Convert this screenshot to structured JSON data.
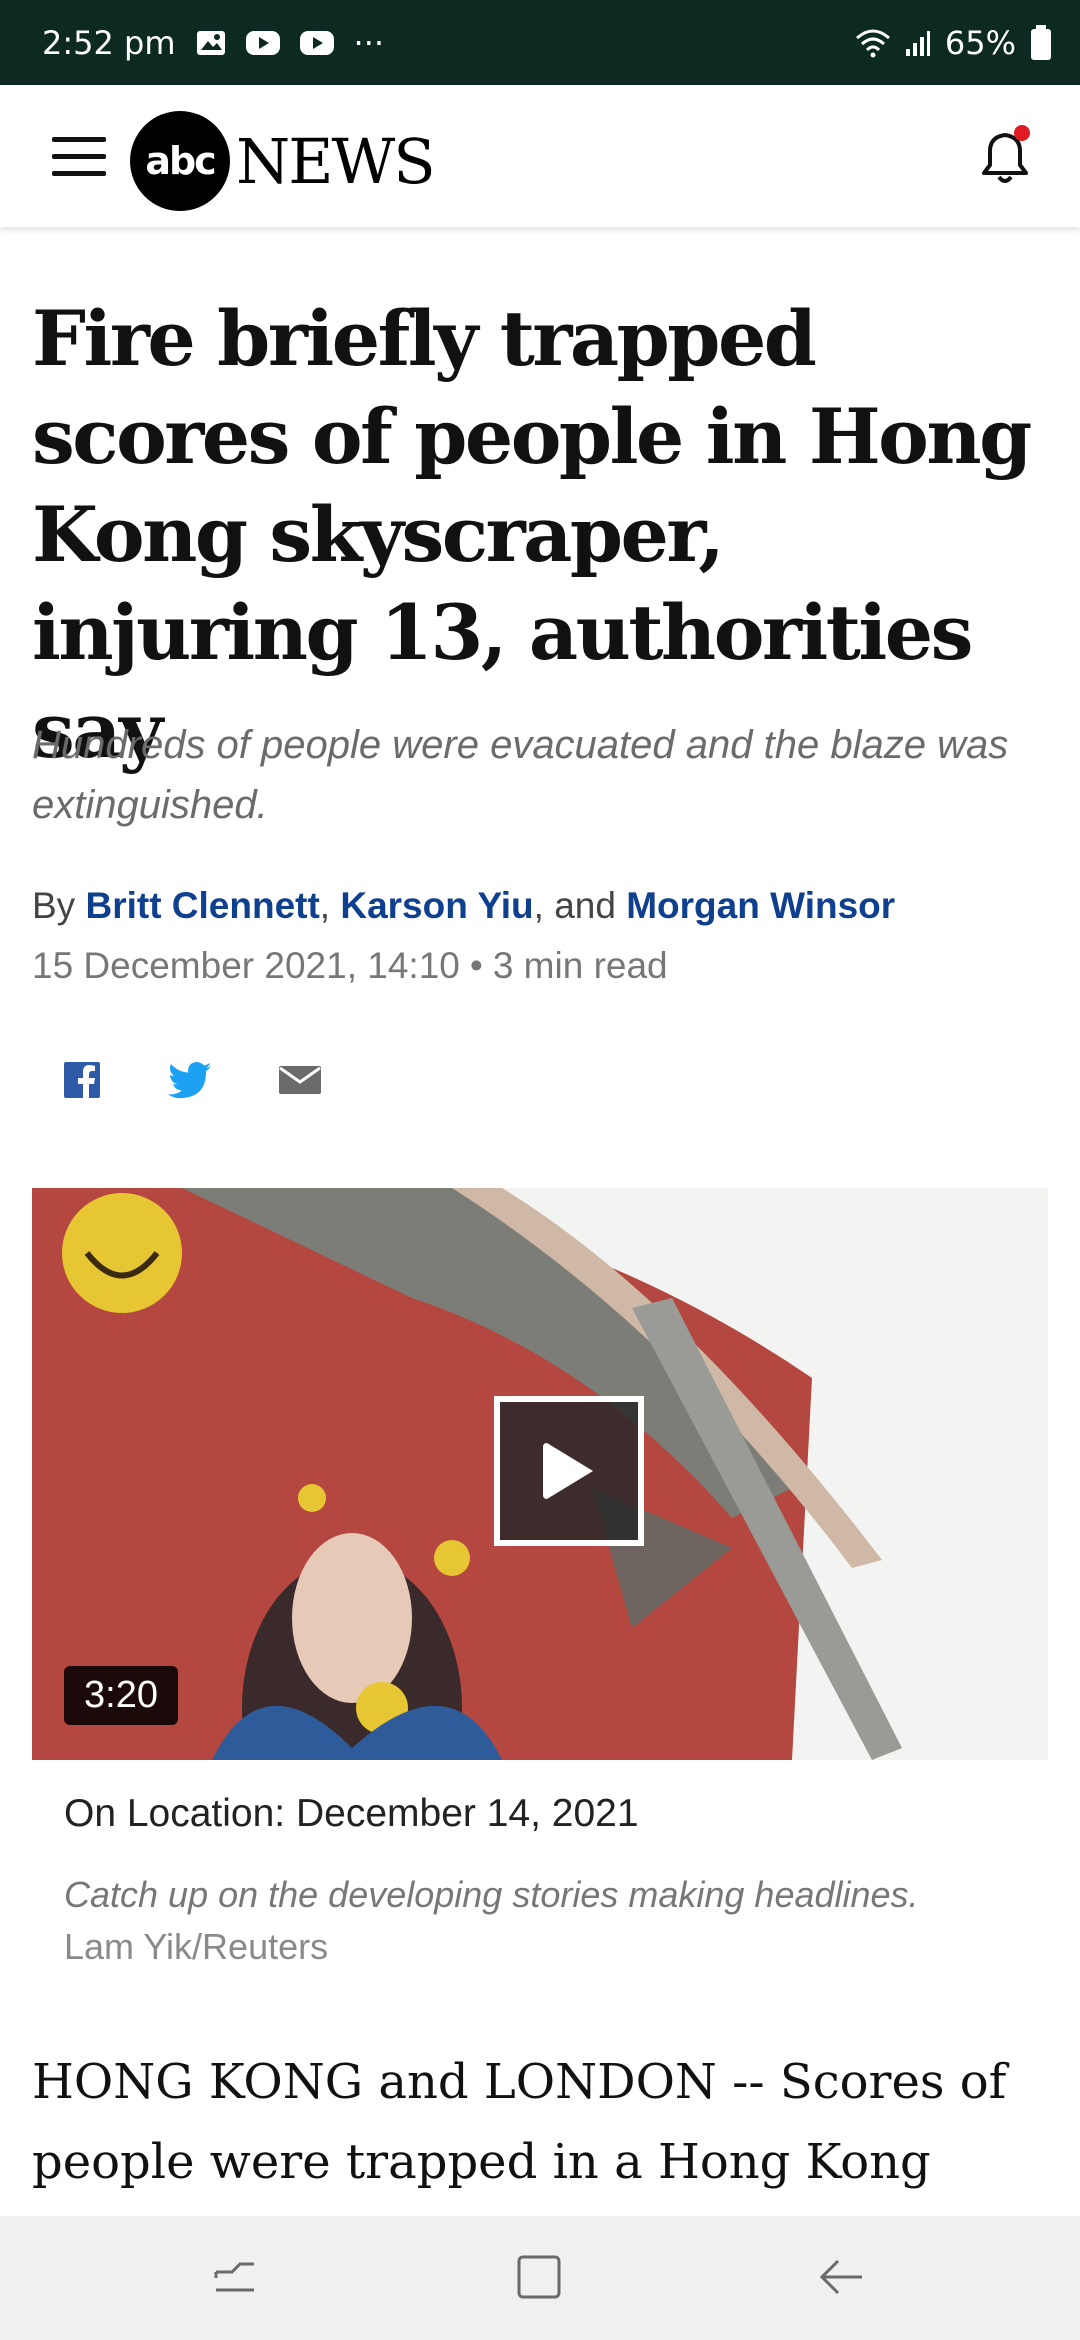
{
  "status_bar": {
    "time": "2:52 pm",
    "more": "···",
    "battery": "65%"
  },
  "header": {
    "logo_abc": "abc",
    "logo_news": "NEWS"
  },
  "article": {
    "headline": "Fire briefly trapped scores of people in Hong Kong skyscraper, injuring 13, authorities say",
    "subhead": "Hundreds of people were evacuated and the blaze was extinguished.",
    "byline": {
      "prefix": "By ",
      "author1": "Britt Clennett",
      "sep1": ", ",
      "author2": "Karson Yiu",
      "sep2": ", and ",
      "author3": "Morgan Winsor"
    },
    "date": "15 December 2021, 14:10",
    "dot": "•",
    "read_time": "3 min read",
    "video": {
      "duration": "3:20",
      "title": "On Location: December 14, 2021",
      "description": "Catch up on the developing stories making headlines.",
      "credit": "Lam Yik/Reuters"
    },
    "body": "HONG KONG and LONDON -- Scores of people were trapped in a Hong Kong"
  },
  "colors": {
    "status_bg": "#0c2a22",
    "author_link": "#0f3f8f",
    "facebook": "#2f5aa8",
    "twitter": "#1da1f2",
    "notification_dot": "#e01b24"
  }
}
